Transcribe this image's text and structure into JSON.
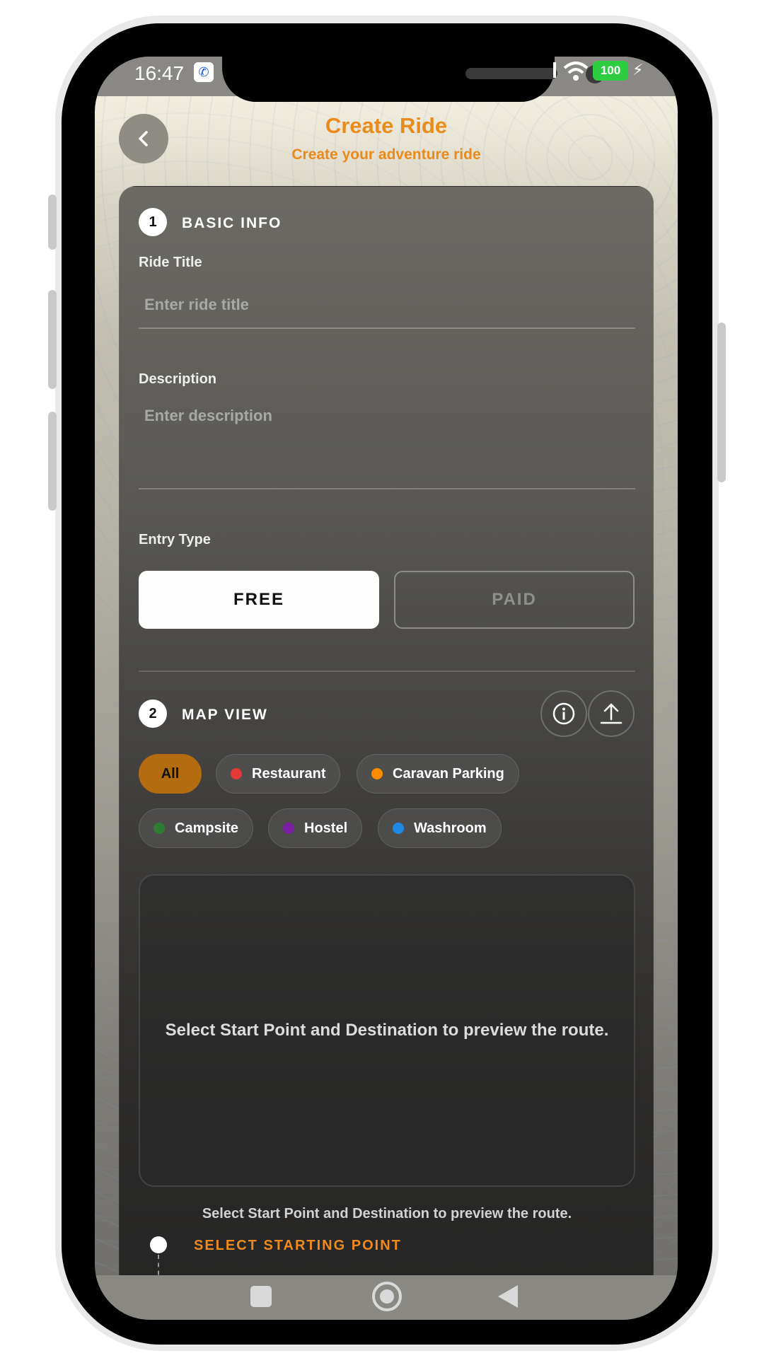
{
  "status_bar": {
    "time": "16:47",
    "battery": "100"
  },
  "header": {
    "title": "Create Ride",
    "subtitle": "Create your adventure ride"
  },
  "basic_info": {
    "step": "1",
    "title": "BASIC INFO",
    "ride_title_label": "Ride Title",
    "ride_title_placeholder": "Enter ride title",
    "description_label": "Description",
    "description_placeholder": "Enter description",
    "entry_type_label": "Entry Type",
    "entry_free": "FREE",
    "entry_paid": "PAID"
  },
  "map_view": {
    "step": "2",
    "title": "MAP VIEW",
    "filters": [
      {
        "label": "All",
        "color": ""
      },
      {
        "label": "Restaurant",
        "color": "#e53935"
      },
      {
        "label": "Caravan Parking",
        "color": "#fb8c00"
      },
      {
        "label": "Campsite",
        "color": "#2e7d32"
      },
      {
        "label": "Hostel",
        "color": "#7b1fa2"
      },
      {
        "label": "Washroom",
        "color": "#1e88e5"
      }
    ],
    "map_message": "Select Start Point and Destination to preview the route.",
    "caption": "Select Start Point and Destination to preview the route.",
    "start_label": "SELECT STARTING POINT"
  },
  "colors": {
    "accent": "#ea8c1c",
    "active_chip": "#b36c10"
  }
}
